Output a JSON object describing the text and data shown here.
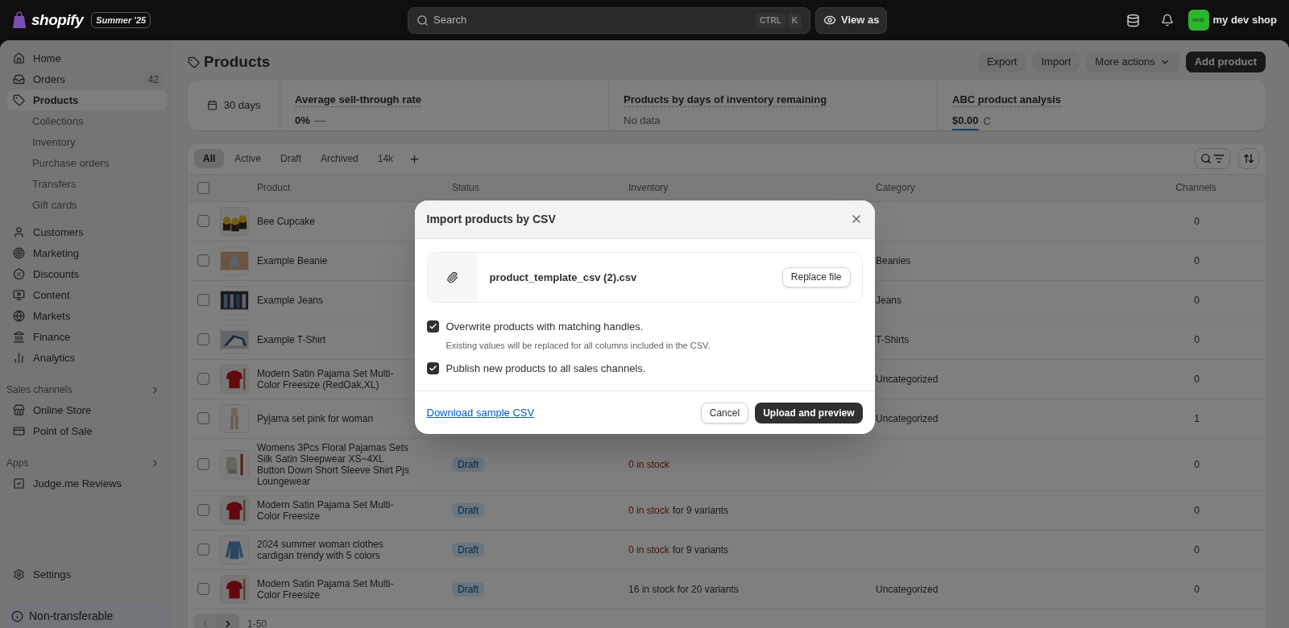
{
  "top_bar": {
    "logo": "shopify",
    "edition": "Summer '25",
    "search": {
      "placeholder": "Search",
      "shortcut": [
        "CTRL",
        "K"
      ]
    },
    "view_as": "View as",
    "store": {
      "initials": "mds",
      "name": "my dev shop"
    }
  },
  "sidebar": {
    "items": [
      {
        "label": "Home",
        "selected": false
      },
      {
        "label": "Orders",
        "selected": false,
        "badge": "42"
      },
      {
        "label": "Products",
        "selected": true,
        "children": [
          {
            "label": "Collections",
            "selected": false
          },
          {
            "label": "Inventory",
            "selected": false
          },
          {
            "label": "Purchase orders",
            "selected": false
          },
          {
            "label": "Transfers",
            "selected": false
          },
          {
            "label": "Gift cards",
            "selected": false
          }
        ]
      },
      {
        "label": "Customers",
        "selected": false
      },
      {
        "label": "Marketing",
        "selected": false
      },
      {
        "label": "Discounts",
        "selected": false
      },
      {
        "label": "Content",
        "selected": false
      },
      {
        "label": "Markets",
        "selected": false
      },
      {
        "label": "Finance",
        "selected": false
      },
      {
        "label": "Analytics",
        "selected": false
      }
    ],
    "sales_channels": {
      "title": "Sales channels",
      "items": [
        {
          "label": "Online Store",
          "selected": false
        },
        {
          "label": "Point of Sale",
          "selected": false
        }
      ]
    },
    "apps": {
      "title": "Apps",
      "items": [
        {
          "label": "Judge.me Reviews",
          "selected": false
        }
      ]
    },
    "settings": "Settings",
    "plan_notice": "Non-transferable"
  },
  "page": {
    "title": "Products",
    "actions": [
      "Export",
      "Import",
      "More actions"
    ],
    "primary_action": "Add product"
  },
  "metrics": {
    "period": "30 days",
    "items": [
      {
        "title": "Average sell-through rate",
        "value": "0%",
        "suffix": "—"
      },
      {
        "title": "Products by days of inventory remaining",
        "value": "No data"
      },
      {
        "title": "ABC product analysis",
        "value": "$0.00",
        "suffix": "C",
        "underlined": true
      }
    ]
  },
  "table": {
    "tabs": [
      {
        "label": "All",
        "selected": true
      },
      {
        "label": "Active",
        "selected": false
      },
      {
        "label": "Draft",
        "selected": false
      },
      {
        "label": "Archived",
        "selected": false
      },
      {
        "label": "14k",
        "selected": false
      }
    ],
    "columns": [
      "Product",
      "Status",
      "Inventory",
      "Category",
      "Channels"
    ],
    "all_checked": false,
    "rows": [
      {
        "checked": false,
        "product": "Bee Cupcake",
        "channels": "0"
      },
      {
        "checked": false,
        "product": "Example Beanie",
        "category": "Beanies",
        "channels": "0"
      },
      {
        "checked": false,
        "product": "Example Jeans",
        "category": "Jeans",
        "channels": "0"
      },
      {
        "checked": false,
        "product": "Example T-Shirt",
        "category": "T-Shirts",
        "channels": "0"
      },
      {
        "checked": false,
        "product": "Modern Satin Pajama Set Multi-Color Freesize (RedOak,XL)",
        "category": "Uncategorized",
        "channels": "0"
      },
      {
        "checked": false,
        "product": "Pyjama set pink for woman",
        "category": "Uncategorized",
        "channels": "1"
      },
      {
        "checked": false,
        "product": "Womens 3Pcs Floral Pajamas Sets Silk Satin Sleepwear XS~4XL Button Down Short Sleeve Shirt Pjs Loungewear",
        "status": "Draft",
        "inventory_alert": "0 in stock",
        "channels": "0"
      },
      {
        "checked": false,
        "product": "Modern Satin Pajama Set Multi-Color Freesize",
        "status": "Draft",
        "inventory_alert": "0 in stock",
        "inventory_note": "for 9 variants",
        "channels": "0"
      },
      {
        "checked": false,
        "product": "2024 summer woman clothes cardigan trendy with 5 colors",
        "status": "Draft",
        "inventory_alert": "0 in stock",
        "inventory_note": "for 9 variants",
        "channels": "0"
      },
      {
        "checked": false,
        "product": "Modern Satin Pajama Set Multi-Color Freesize",
        "status": "Draft",
        "inventory_note": "16 in stock for 20 variants",
        "category": "Uncategorized",
        "channels": "0"
      }
    ],
    "pagination": "1-50"
  },
  "dialog": {
    "title": "Import products by CSV",
    "file": {
      "name": "product_template_csv (2).csv",
      "action": "Replace file"
    },
    "options": [
      {
        "label": "Overwrite products with matching handles.",
        "checked": true,
        "help": "Existing values will be replaced for all columns included in the CSV."
      },
      {
        "label": "Publish new products to all sales channels.",
        "checked": true
      }
    ],
    "link": "Download sample CSV",
    "buttons": [
      {
        "label": "Cancel",
        "kind": "secondary"
      },
      {
        "label": "Upload and preview",
        "kind": "primary"
      }
    ]
  }
}
